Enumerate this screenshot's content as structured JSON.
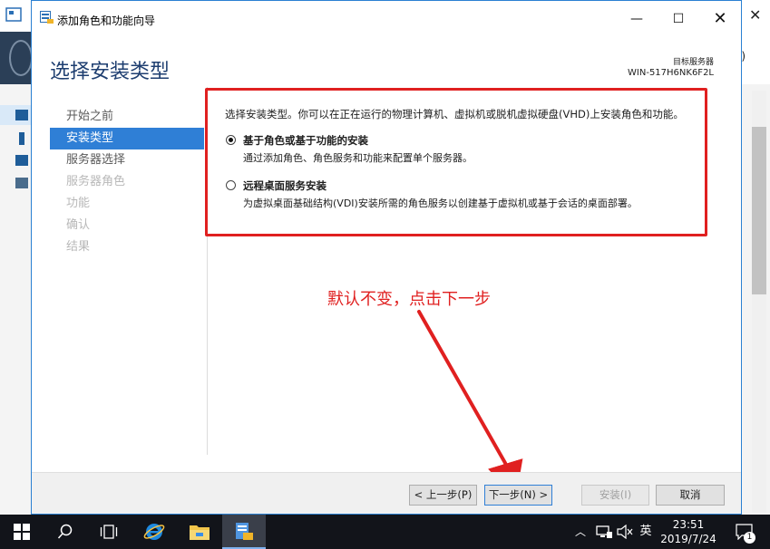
{
  "window": {
    "title": "添加角色和功能向导",
    "page_title": "选择安装类型",
    "target_server_label": "目标服务器",
    "target_server_name": "WIN-517H6NK6F2L"
  },
  "nav": {
    "items": [
      {
        "label": "开始之前",
        "state": "normal"
      },
      {
        "label": "安装类型",
        "state": "active"
      },
      {
        "label": "服务器选择",
        "state": "normal"
      },
      {
        "label": "服务器角色",
        "state": "disabled"
      },
      {
        "label": "功能",
        "state": "disabled"
      },
      {
        "label": "确认",
        "state": "disabled"
      },
      {
        "label": "结果",
        "state": "disabled"
      }
    ]
  },
  "content": {
    "intro": "选择安装类型。你可以在正在运行的物理计算机、虚拟机或脱机虚拟硬盘(VHD)上安装角色和功能。",
    "options": [
      {
        "title": "基于角色或基于功能的安装",
        "desc": "通过添加角色、角色服务和功能来配置单个服务器。",
        "checked": true
      },
      {
        "title": "远程桌面服务安装",
        "desc": "为虚拟桌面基础结构(VDI)安装所需的角色服务以创建基于虚拟机或基于会话的桌面部署。",
        "checked": false
      }
    ]
  },
  "annotation": {
    "text": "默认不变，点击下一步",
    "color": "#e02020"
  },
  "footer": {
    "prev_label": "< 上一步(P)",
    "next_label": "下一步(N) >",
    "install_label": "安装(I)",
    "cancel_label": "取消"
  },
  "taskbar": {
    "ime_label": "英",
    "time": "23:51",
    "date": "2019/7/24",
    "notification_count": "1"
  },
  "background": {
    "right_nav_text": "l)"
  },
  "colors": {
    "accent": "#2f7fd6",
    "title": "#1e3e70",
    "annotation_red": "#e02020"
  }
}
